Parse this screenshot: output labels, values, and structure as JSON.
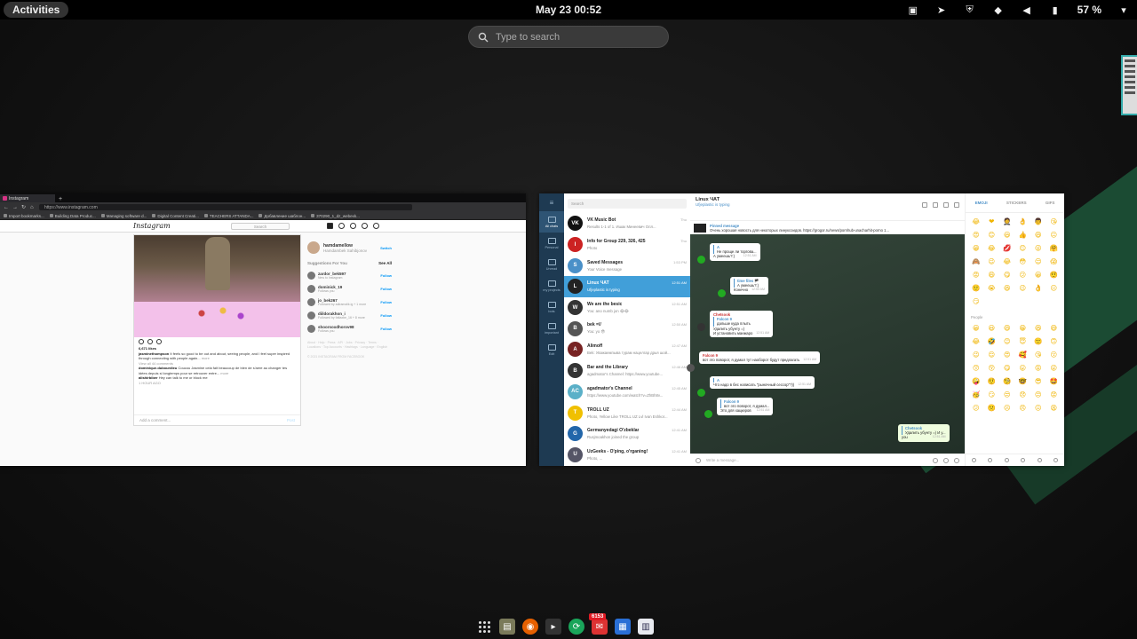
{
  "topbar": {
    "activities": "Activities",
    "clock": "May 23  00:52",
    "battery": "57 %"
  },
  "search": {
    "placeholder": "Type to search"
  },
  "instagram_window": {
    "tab_title": "Instagram",
    "url": "https://www.instagram.com",
    "bookmarks": [
      "Import bookmarks...",
      "Building Data Produc...",
      "Managing software d...",
      "Digital Content Creati...",
      "TEACHERS ATTANDA...",
      "Добавление шаблон...",
      "370290_1_dz_webexk..."
    ],
    "header": {
      "logo": "Instagram",
      "search": "Search"
    },
    "post": {
      "likes": "6,671 likes",
      "caption_user": "jasminethompson",
      "caption": "It feels so good to be out and about, seeing people, and I feel super inspired through connecting with people again...",
      "more": "more",
      "view_comments": "View all 44 comments",
      "comment1_user": "dominique.dubourdieu",
      "comment1": "Coucou Jasmine cela fait beaucoup de bien de s'aere au changer tes idées depuis si longtemps pour se retrouver entre...",
      "comment1_more": "more",
      "comment2_user": "alishirbiber",
      "comment2": "Hey can talk to me or block me",
      "time": "1 HOUR AGO",
      "add_comment": "Add a comment...",
      "post_btn": "Post"
    },
    "post2_user": "bebenaha",
    "sidebar": {
      "username": "hamdamellow",
      "fullname": "Hamdambek Sahibjonov",
      "switch": "Switch",
      "suggestions_title": "Suggestions For You",
      "see_all": "See All",
      "follow": "Follow",
      "suggestions": [
        {
          "name": "zardor_bek597",
          "sub": "New to Instagram"
        },
        {
          "name": "dominick_19",
          "sub": "Follows you"
        },
        {
          "name": "jo_bek267",
          "sub": "Followed by adiramalik.ig + 1 more"
        },
        {
          "name": "diildorakhon_i",
          "sub": "Followed by fattaxbe_16 + 8 more"
        },
        {
          "name": "shoorsoxdhorov98",
          "sub": "Follows you"
        }
      ],
      "footer": "About · Help · Press · API · Jobs · Privacy · Terms · Locations · Top Accounts · Hashtags · Language · English",
      "copyright": "© 2021 INSTAGRAM FROM FACEBOOK"
    }
  },
  "telegram_window": {
    "search": "Search",
    "rail": [
      {
        "label": "All chats",
        "badge": "26"
      },
      {
        "label": "Personal"
      },
      {
        "label": "Unread",
        "badge": "29"
      },
      {
        "label": "my projects"
      },
      {
        "label": "bots"
      },
      {
        "label": "important"
      },
      {
        "label": "Edit"
      }
    ],
    "chats": [
      {
        "name": "VK Music Bot",
        "time": "Thu",
        "preview": "Results 1-1 of 1. Ишак Минеевич  Олл...",
        "color": "#111",
        "init": "VK"
      },
      {
        "name": "Info for Group 229, 326, 425",
        "time": "Thu",
        "preview": "Photo",
        "color": "#c22",
        "init": "I"
      },
      {
        "name": "Saved Messages",
        "time": "1:53 PM",
        "preview": "Your Voice message",
        "color": "#4a90c8",
        "init": "S"
      },
      {
        "name": "Linux ЧАТ",
        "time": "12:51 AM",
        "preview": "Ufjeplastic is typing",
        "color": "#222",
        "init": "L",
        "selected": true
      },
      {
        "name": "We are the besic",
        "time": "12:51 AM",
        "preview": "You: ano numb jon 😂😂",
        "color": "#333",
        "init": "W"
      },
      {
        "name": "bek =\\/",
        "time": "12:50 AM",
        "preview": "You: yo 😎",
        "color": "#555",
        "init": "B"
      },
      {
        "name": "Alimoff",
        "time": "12:47 AM",
        "preview": "Bek: Уважаемпыва турам нацелгар дрья шой...",
        "color": "#722",
        "init": "A"
      },
      {
        "name": "Bar and the Library",
        "time": "12:46 AM",
        "preview": "agadmator's Channel: https://www.youtube...",
        "color": "#333",
        "init": "B"
      },
      {
        "name": "agadmator's Channel",
        "time": "12:45 AM",
        "preview": "https://www.youtube.com/watch?v=ZhBh8v...",
        "color": "#5ab0c8",
        "init": "AC"
      },
      {
        "name": "TROLL UZ",
        "time": "12:44 AM",
        "preview": "Photo, Yellow Like TROLL UZ Lvl Ivan Eshkor...",
        "color": "#f0c000",
        "init": "T"
      },
      {
        "name": "Germanyedagi O'zbeklar",
        "time": "12:41 AM",
        "preview": "Rusjmoakhon joined the group",
        "color": "#2266aa",
        "init": "G"
      },
      {
        "name": "UzGeeks - O'ping, o'rganing!",
        "time": "12:41 AM",
        "preview": "Photo, ...",
        "color": "#556",
        "init": "U"
      }
    ],
    "chat_header": {
      "title": "Linux ЧАТ",
      "typing": "Ufjeplastic is typing"
    },
    "pinned": {
      "label": "Pinned message",
      "text": "Очень хорошая новость для некоторых линуксоидов. https://grogor.ru/news/pornhub-unacharhit-porno 1..."
    },
    "messages": [
      {
        "quote_name": "A",
        "quote": "Не проще ли торгова...",
        "text": "А умеешь?:)",
        "time": "12:51 AM"
      },
      {
        "quote_name": "time files 🏴",
        "quote": "А умеешь?:)",
        "text": "Конечно",
        "time": "12:50 AM"
      },
      {
        "who": "Chetsook",
        "quote_name": "Falcon 9",
        "quote": "дальше куда плыть",
        "text": "Удалить убунту =)\nИ установить манжаро",
        "time": "12:51 AM"
      },
      {
        "who": "Falcon 9",
        "text": "вот это поворот, я думал тут наоборот будут предлагать",
        "time": "12:51 AM"
      },
      {
        "quote_name": "A",
        "quote": "",
        "text": "Что надо в бес написать \"рыночный сессор\"?))",
        "time": "12:51 AM"
      },
      {
        "quote_name": "Falcon 9",
        "quote": "вот это поворот, я думал...",
        "text": "Это для хацкеров",
        "time": "12:51 AM"
      },
      {
        "quote_name": "Chetsook",
        "quote": "Удалить убунту =) И у...",
        "text": "you",
        "time": "12:51 AM",
        "out": true
      }
    ],
    "input_placeholder": "Write a message...",
    "emoji_tabs": [
      "EMOJI",
      "STICKERS",
      "GIFS"
    ],
    "emoji_recent": [
      "😂",
      "❤",
      "🤵",
      "👌",
      "👨",
      "😘",
      "😍",
      "😊",
      "😃",
      "👍",
      "😄",
      "😐",
      "😁",
      "😂",
      "💋",
      "😊",
      "😜",
      "🤗",
      "🙈",
      "😉",
      "😂",
      "😳",
      "😌",
      "😱",
      "😡",
      "😄",
      "😋",
      "😕",
      "😀",
      "🤨",
      "🙂",
      "😭",
      "😆",
      "😉",
      "👌",
      "😐",
      "😏"
    ],
    "people_label": "People",
    "emoji_people": [
      "😀",
      "😃",
      "😄",
      "😁",
      "😆",
      "😅",
      "😂",
      "🤣",
      "😊",
      "😇",
      "🙂",
      "🙃",
      "😉",
      "😌",
      "😍",
      "🥰",
      "😘",
      "😗",
      "😙",
      "😚",
      "😋",
      "😛",
      "😝",
      "😜",
      "🤪",
      "🤨",
      "🧐",
      "🤓",
      "😎",
      "🤩",
      "🥳",
      "😏",
      "😒",
      "😞",
      "😔",
      "😟",
      "😕",
      "🙁",
      "☹",
      "😣",
      "😖",
      "😫"
    ]
  },
  "dash": {
    "badge": "6153"
  }
}
